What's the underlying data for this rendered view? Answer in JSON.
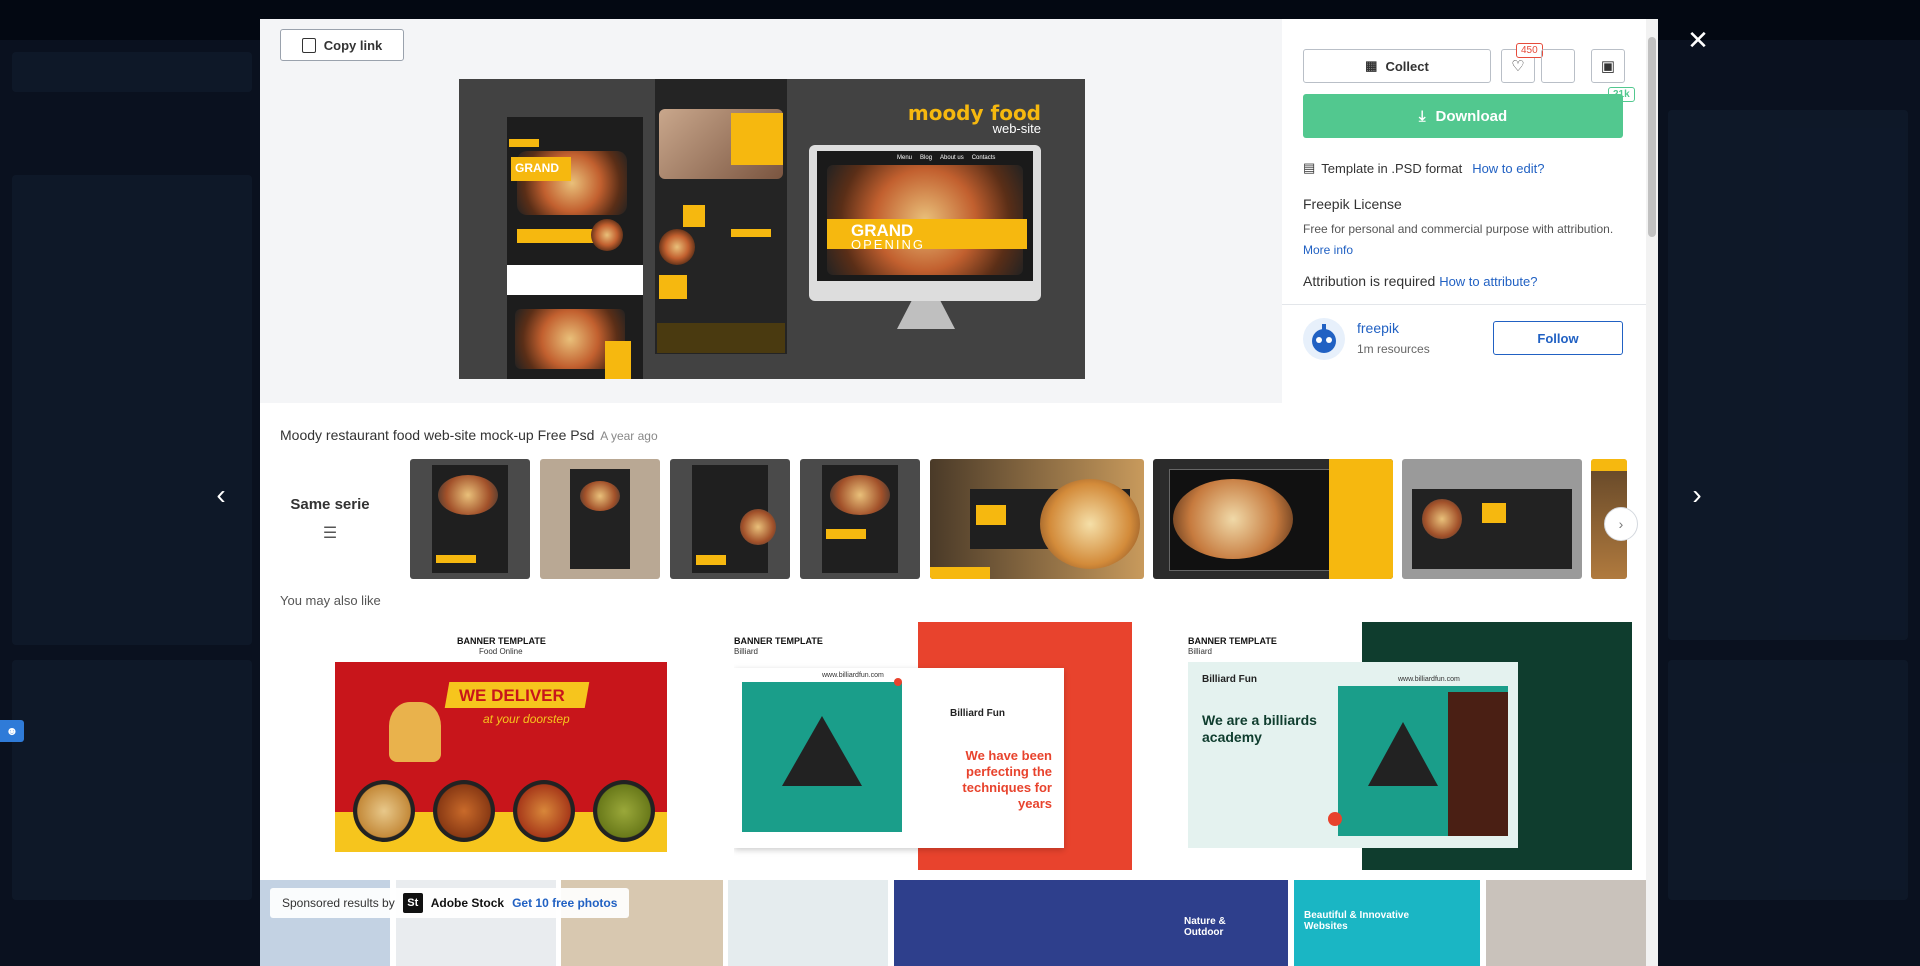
{
  "preview": {
    "copy_link_label": "Copy link",
    "mock_title": "moody food",
    "mock_subtitle": "web-site",
    "mock_grand": "GRAND",
    "mock_opening": "OPENING",
    "mock_menu": [
      "Menu",
      "Blog",
      "About us",
      "Contacts"
    ]
  },
  "info": {
    "collect_label": "Collect",
    "like_count": "450",
    "download_label": "Download",
    "download_count": "21k",
    "format_text": "Template in .PSD format",
    "how_to_edit": "How to edit?",
    "license_title": "Freepik License",
    "license_text": "Free for personal and commercial purpose with attribution.",
    "more_info": "More info",
    "attribution_text": "Attribution is required",
    "how_to_attribute": "How to attribute?",
    "author_name": "freepik",
    "author_resources": "1m resources",
    "follow_label": "Follow"
  },
  "resource": {
    "title": "Moody restaurant food web-site mock-up Free Psd",
    "age": "A year ago",
    "same_serie_label": "Same serie"
  },
  "also_like_label": "You may also like",
  "cards": [
    {
      "heading": "BANNER TEMPLATE",
      "sub": "Food Online",
      "headline": "WE DELIVER",
      "tagline": "at your doorstep"
    },
    {
      "heading": "BANNER TEMPLATE",
      "sub": "Billiard",
      "brand": "Billiard Fun",
      "url": "www.billiardfun.com",
      "headline": "We have been perfecting the techniques for years"
    },
    {
      "heading": "BANNER TEMPLATE",
      "sub": "Billiard",
      "brand": "Billiard Fun",
      "url": "www.billiardfun.com",
      "headline": "We are a billiards academy"
    }
  ],
  "sponsor": {
    "prefix": "Sponsored results by",
    "brand": "Adobe Stock",
    "cta": "Get 10 free photos",
    "thumb_texts": [
      "Nature & Outdoor",
      "Beautiful & Innovative Websites"
    ]
  },
  "colors": {
    "accent_green": "#52c88f",
    "link_blue": "#2161c3",
    "brand_yellow": "#f6b80f",
    "like_red": "#e64b3b"
  }
}
